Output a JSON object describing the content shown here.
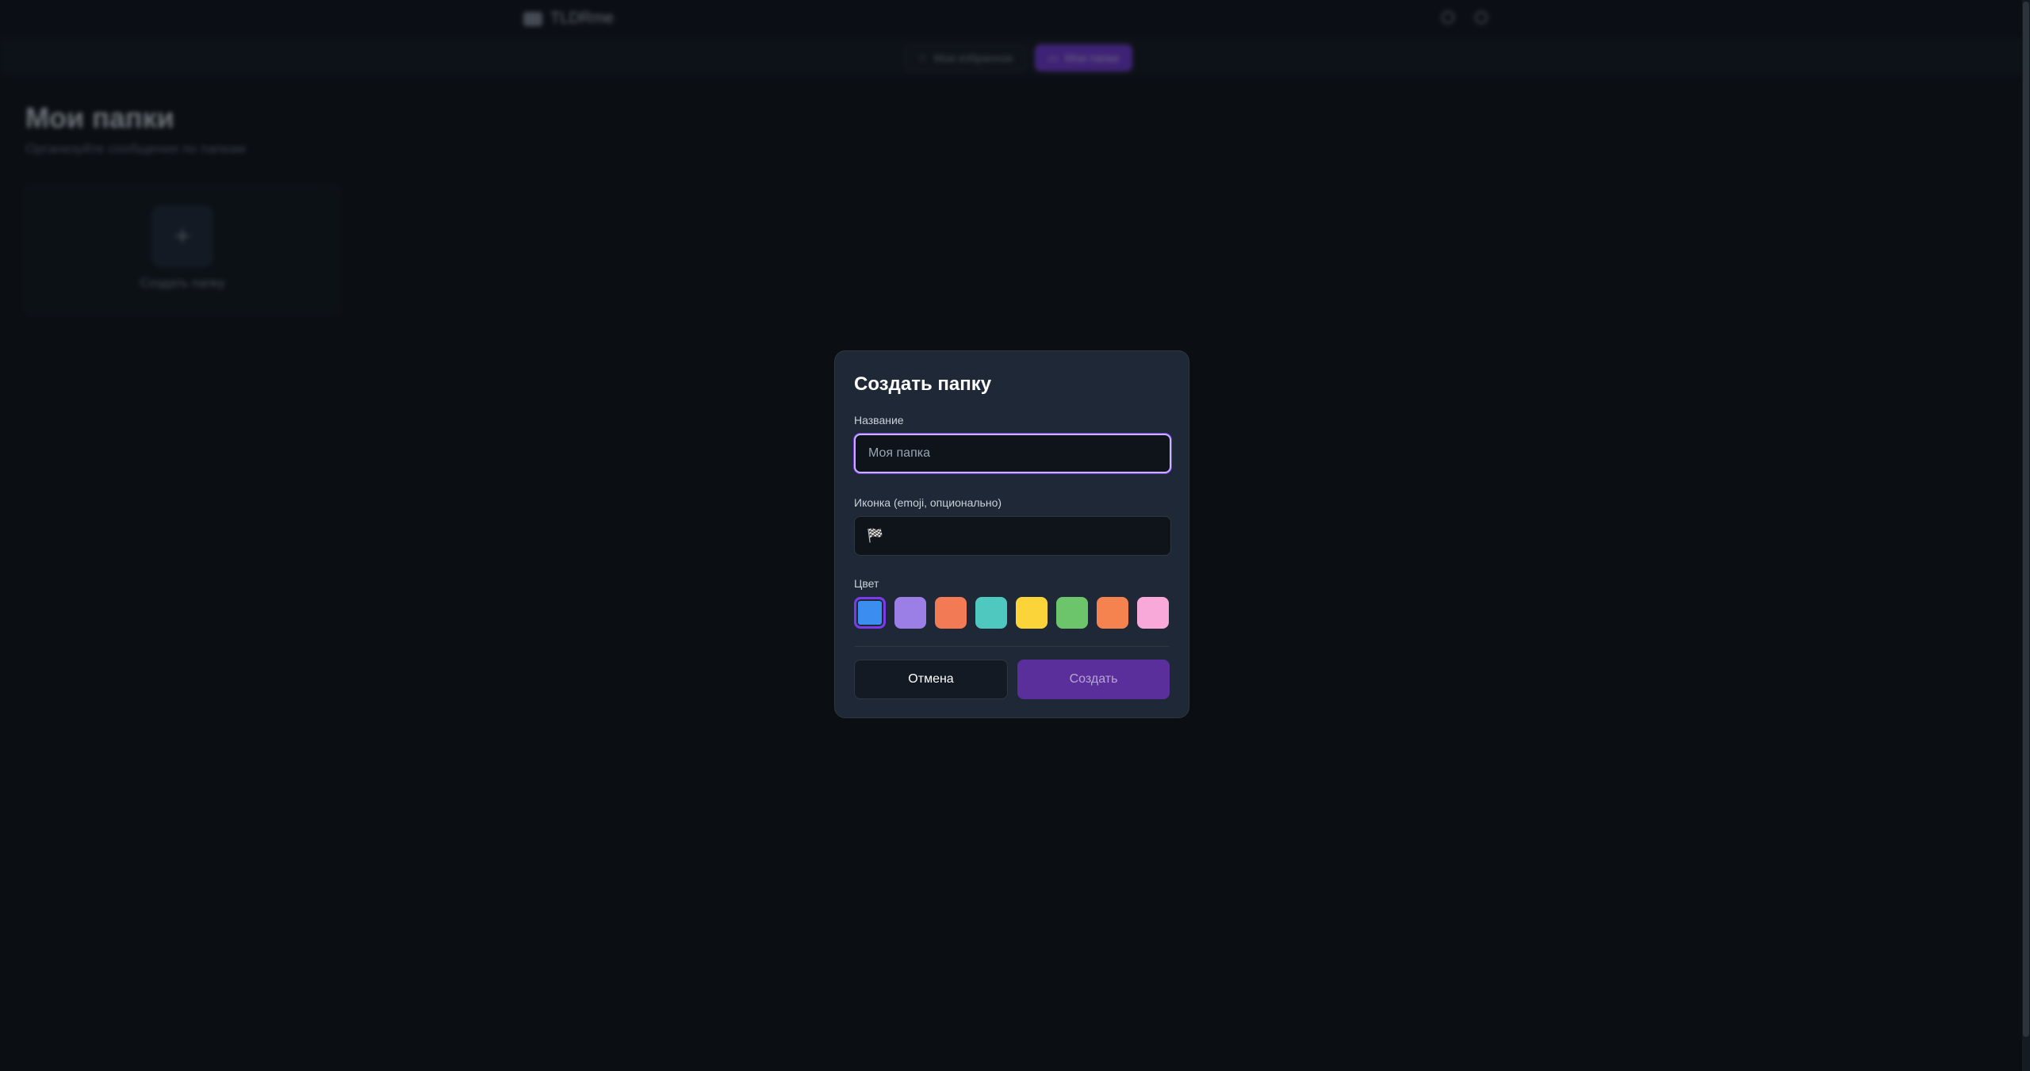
{
  "app": {
    "brand": "TLDRme"
  },
  "subnav": {
    "items": [
      {
        "label": "Мои избранное",
        "active": false
      },
      {
        "label": "Мои папки",
        "active": true
      }
    ]
  },
  "page": {
    "title": "Мои папки",
    "subtitle": "Организуйте сообщения по папкам",
    "create_card_plus": "+",
    "create_card_label": "Создать папку"
  },
  "modal": {
    "title": "Создать папку",
    "name_label": "Название",
    "name_placeholder": "Моя папка",
    "name_value": "",
    "icon_label": "Иконка (emoji, опционально)",
    "icon_value": "🏁",
    "color_label": "Цвет",
    "colors": [
      "#3b8ef0",
      "#9b7ee6",
      "#f27a55",
      "#4fc9bf",
      "#fbd43a",
      "#6cc56b",
      "#f5834f",
      "#f8a9da"
    ],
    "selected_color_index": 0,
    "cancel_label": "Отмена",
    "create_label": "Создать"
  }
}
